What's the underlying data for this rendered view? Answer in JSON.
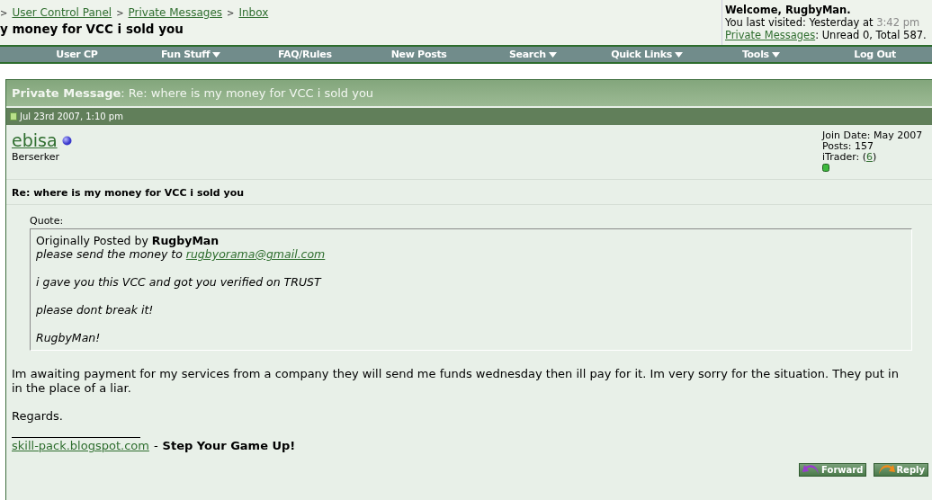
{
  "breadcrumb": [
    {
      "kind": "separator",
      "text": ">"
    },
    {
      "kind": "link",
      "text": "User Control Panel"
    },
    {
      "kind": "separator",
      "text": ">"
    },
    {
      "kind": "link",
      "text": "Private Messages"
    },
    {
      "kind": "separator",
      "text": ">"
    },
    {
      "kind": "link",
      "text": "Inbox"
    }
  ],
  "page_title": "y money for VCC i sold you",
  "welcome": {
    "greeting": "Welcome, RugbyMan.",
    "last_visited_label": "You last visited: Yesterday at",
    "last_visited_time": "3:42 pm",
    "pm_link": "Private Messages",
    "pm_counts": ": Unread 0, Total 587."
  },
  "nav": [
    {
      "label": "User CP",
      "dropdown": false
    },
    {
      "label": "Fun Stuff",
      "dropdown": true
    },
    {
      "label": "FAQ/Rules",
      "dropdown": false
    },
    {
      "label": "New Posts",
      "dropdown": false
    },
    {
      "label": "Search",
      "dropdown": true
    },
    {
      "label": "Quick Links",
      "dropdown": true
    },
    {
      "label": "Tools",
      "dropdown": true
    },
    {
      "label": "Log Out",
      "dropdown": false
    }
  ],
  "message": {
    "header_label": "Private Message",
    "header_colon": ":",
    "header_subject": "Re: where is my money for VCC i sold you",
    "date": "Jul 23rd 2007, 1:10 pm",
    "author": {
      "name": "ebisa",
      "online": true,
      "rank": "Berserker"
    },
    "stats": {
      "join_date": "Join Date: May 2007",
      "posts": "Posts: 157",
      "itrader_label": "iTrader: (",
      "itrader_count": "6",
      "itrader_close": ")",
      "itrader_positive": true
    },
    "subject": "Re: where is my money for VCC i sold you",
    "quote": {
      "label": "Quote:",
      "attribution": "Originally Posted by **RugbyMan**",
      "lines": [
        {
          "text": "please send the money to",
          "link": "rugbyorama@gmail.com"
        },
        {
          "text": "i gave you this VCC and got you verified on TRUST"
        },
        {
          "text": "please dont break it!"
        },
        {
          "text": "RugbyMan!"
        }
      ]
    },
    "body": [
      "Im awaiting payment for my services from a company they will send me funds wednesday then ill pay for it. Im very sorry for the situation. They put in in the place of a liar.",
      "Regards."
    ],
    "signature": {
      "link": "skill-pack.blogspot.com",
      "separator": "-",
      "slogan": "Step Your Game Up!"
    },
    "buttons": [
      {
        "kind": "forward",
        "label": "Forward"
      },
      {
        "kind": "reply",
        "label": "Reply"
      }
    ]
  }
}
